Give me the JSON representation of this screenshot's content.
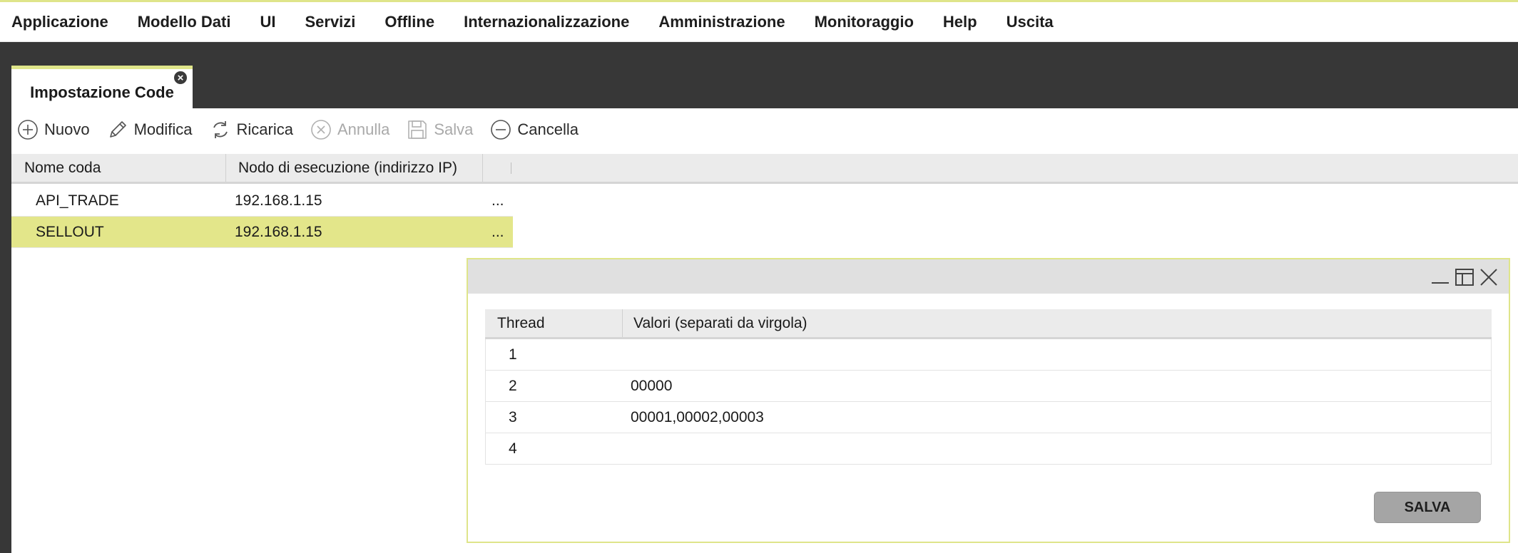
{
  "menu": {
    "items": [
      "Applicazione",
      "Modello Dati",
      "UI",
      "Servizi",
      "Offline",
      "Internazionalizzazione",
      "Amministrazione",
      "Monitoraggio",
      "Help",
      "Uscita"
    ]
  },
  "tab": {
    "label": "Impostazione Code",
    "close_glyph": "×"
  },
  "toolbar": {
    "nuovo": "Nuovo",
    "modifica": "Modifica",
    "ricarica": "Ricarica",
    "annulla": "Annulla",
    "salva": "Salva",
    "cancella": "Cancella"
  },
  "grid": {
    "columns": [
      "Nome coda",
      "Nodo di esecuzione (indirizzo IP)"
    ],
    "rows": [
      {
        "name": "API_TRADE",
        "ip": "192.168.1.15",
        "more": "...",
        "selected": false
      },
      {
        "name": "SELLOUT",
        "ip": "192.168.1.15",
        "more": "...",
        "selected": true
      }
    ]
  },
  "dialog": {
    "columns": [
      "Thread",
      "Valori (separati da virgola)"
    ],
    "rows": [
      {
        "thread": "1",
        "values": ""
      },
      {
        "thread": "2",
        "values": "00000"
      },
      {
        "thread": "3",
        "values": "00001,00002,00003"
      },
      {
        "thread": "4",
        "values": ""
      }
    ],
    "save_label": "SALVA"
  },
  "colors": {
    "accent": "#dfe58a",
    "selected_row": "#e3e68a",
    "dark_band": "#373737"
  }
}
